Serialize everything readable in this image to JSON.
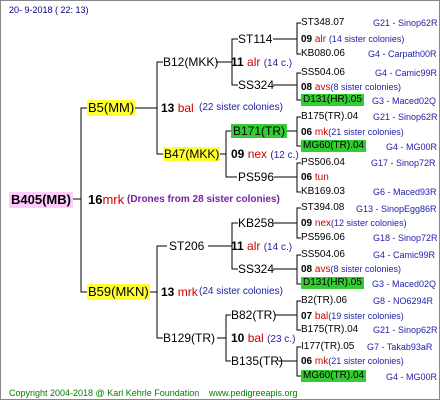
{
  "header": {
    "date": "20-  9-2018 ( 22: 13)"
  },
  "root": {
    "name": "B405(MB)",
    "count": "16",
    "code": "mrk",
    "note": "(Drones from 28 sister colonies)"
  },
  "upper": {
    "parent": {
      "name": "B5(MM)",
      "count": "13",
      "code": "bal",
      "note": "(22 sister colonies)"
    },
    "gp1": {
      "name": "B12(MKK)",
      "count": "11",
      "code": "alr",
      "note": "(14 c.)"
    },
    "gp2": {
      "name": "B47(MKK)",
      "count": "09",
      "code": "nex",
      "note": "(12 c.)"
    },
    "rows": [
      {
        "id": "ST348.07",
        "ref": "G21 - Sinop62R"
      },
      {
        "count": "09",
        "code": "alr",
        "note": "(14 sister colonies)"
      },
      {
        "id": "KB080.06",
        "ref": "G4 - Carpath00R"
      },
      {
        "id": "SS504.06",
        "ref": "G4 - Camic99R"
      },
      {
        "count": "08",
        "code": "avs",
        "note": "(8 sister colonies)"
      },
      {
        "id": "D131(HR).05",
        "ref": "G3 - Maced02Q"
      },
      {
        "id": "B175(TR).04",
        "ref": "G21 - Sinop62R"
      },
      {
        "count": "06",
        "code": "mk",
        "note": "(21 sister colonies)"
      },
      {
        "id": "MG60(TR).04",
        "ref": "G4 - MG00R"
      },
      {
        "id": "PS506.04",
        "ref": "G17 - Sinop72R"
      },
      {
        "count": "06",
        "code": "tun",
        "note": ""
      },
      {
        "id": "KB169.03",
        "ref": "G6 - Maced93R"
      }
    ],
    "n1": "ST114",
    "n1b": "SS324",
    "n2": "B171(TR)",
    "n2b": "PS596"
  },
  "lower": {
    "parent": {
      "name": "B59(MKN)",
      "count": "13",
      "code": "mrk",
      "note": "(24 sister colonies)"
    },
    "gp1": {
      "name": "ST206",
      "count": "11",
      "code": "alr",
      "note": "(14 c.)"
    },
    "gp2": {
      "name": "B129(TR)",
      "count": "10",
      "code": "bal",
      "note": "(23 c.)"
    },
    "rows": [
      {
        "id": "ST394.08",
        "ref": "G13 - SinopEgg86R"
      },
      {
        "count": "09",
        "code": "nex",
        "note": "(12 sister colonies)"
      },
      {
        "id": "PS596.06",
        "ref": "G18 - Sinop72R"
      },
      {
        "id": "SS504.06",
        "ref": "G4 - Camic99R"
      },
      {
        "count": "08",
        "code": "avs",
        "note": "(8 sister colonies)"
      },
      {
        "id": "D131(HR).05",
        "ref": "G3 - Maced02Q"
      },
      {
        "id": "B2(TR).06",
        "ref": "G8 - NO6294R"
      },
      {
        "count": "07",
        "code": "bal",
        "note": "(19 sister colonies)"
      },
      {
        "id": "B175(TR).04",
        "ref": "G21 - Sinop62R"
      },
      {
        "id": "I177(TR).05",
        "ref": "G7 - Takab93aR"
      },
      {
        "count": "06",
        "code": "mk",
        "note": "(21 sister colonies)"
      },
      {
        "id": "MG60(TR).04",
        "ref": "G4 - MG00R"
      }
    ],
    "n1": "KB258",
    "n1b": "SS324",
    "n2": "B82(TR)",
    "n2b": "B135(TR)"
  },
  "footer": {
    "copyright": "Copyright 2004-2018 @ Karl Kehrle Foundation",
    "site": "www.pedigreeapis.org"
  }
}
